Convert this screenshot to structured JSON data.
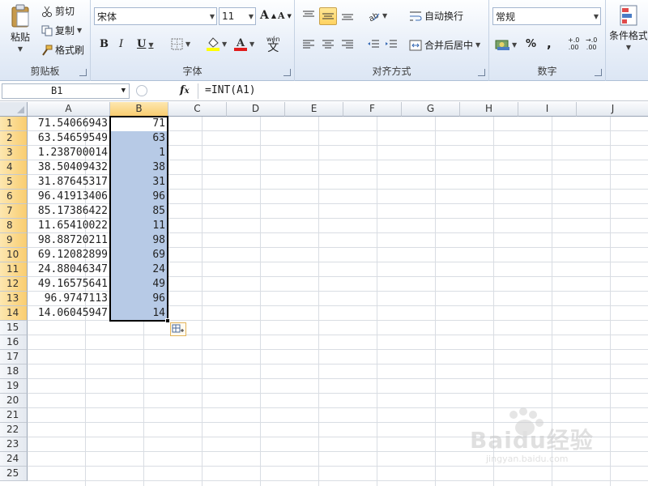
{
  "clipboard": {
    "paste": "粘贴",
    "cut": "剪切",
    "copy": "复制",
    "format_painter": "格式刷",
    "label": "剪贴板"
  },
  "font": {
    "name": "宋体",
    "size": "11",
    "bold": "B",
    "italic": "I",
    "underline": "U",
    "grow": "A",
    "shrink": "A",
    "wen": "wén",
    "wen_char": "文",
    "label": "字体"
  },
  "align": {
    "wrap_text": "自动换行",
    "merge_center": "合并后居中",
    "label": "对齐方式"
  },
  "number": {
    "format": "常规",
    "percent": "%",
    "comma": ",",
    "inc_dec": "+.0",
    "inc_dec2": ".00",
    "dec_dec": "→.0",
    "dec_dec2": ".00",
    "label": "数字"
  },
  "styles": {
    "conditional": "条件格式"
  },
  "formula_bar": {
    "name_box": "B1",
    "fx": "fx",
    "formula": "=INT(A1)"
  },
  "columns": [
    "A",
    "B",
    "C",
    "D",
    "E",
    "F",
    "G",
    "H",
    "I",
    "J"
  ],
  "rows": [
    "1",
    "2",
    "3",
    "4",
    "5",
    "6",
    "7",
    "8",
    "9",
    "10",
    "11",
    "12",
    "13",
    "14",
    "15",
    "16",
    "17",
    "18",
    "19",
    "20",
    "21",
    "22",
    "23",
    "24",
    "25"
  ],
  "col_a": [
    "71.54066943",
    "63.54659549",
    "1.238700014",
    "38.50409432",
    "31.87645317",
    "96.41913406",
    "85.17386422",
    "11.65410022",
    "98.88720211",
    "69.12082899",
    "24.88046347",
    "49.16575641",
    "96.9747113",
    "14.06045947"
  ],
  "col_b": [
    "71",
    "63",
    "1",
    "38",
    "31",
    "96",
    "85",
    "11",
    "98",
    "69",
    "24",
    "49",
    "96",
    "14"
  ],
  "watermark": {
    "text": "Baidu经验",
    "sub": "jingyan.baidu.com"
  },
  "colors": {
    "selection": "#b7cae6",
    "header_selected": "#f9cd70",
    "accent_active": "#ffd260",
    "font_color": "#e01c1c",
    "highlight": "#ffff00"
  }
}
